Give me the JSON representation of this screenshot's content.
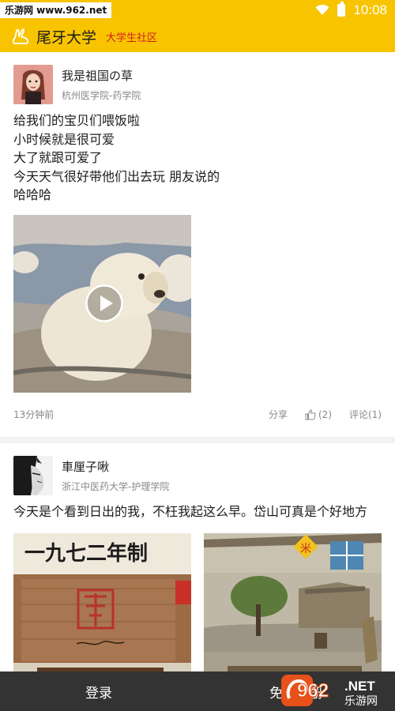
{
  "status_bar": {
    "watermark": "乐游网 www.962.net",
    "time": "10:08"
  },
  "app_bar": {
    "title": "尾牙大学",
    "subtitle": "大学生社区",
    "accent": "#f8c400"
  },
  "posts": [
    {
      "author": "我是祖国の草",
      "school": "杭州医学院-药学院",
      "lines": [
        "给我们的宝贝们喂饭啦",
        "小时候就是很可爱",
        "大了就跟可爱了",
        "今天天气很好带他们出去玩 朋友说的",
        "哈哈哈"
      ],
      "media": "video",
      "time": "13分钟前",
      "share_label": "分享",
      "likes": "(2)",
      "comments_label": "评论(1)"
    },
    {
      "author": "車厘子啾",
      "school": "浙江中医药大学-护理学院",
      "lines": [
        "今天是个看到日出的我，不枉我起这么早。岱山可真是个好地方"
      ],
      "media": "images",
      "images": [
        {
          "caption": "一九七二年制",
          "seal": "宣和"
        },
        {
          "sign": "米"
        }
      ]
    }
  ],
  "bottom_bar": {
    "login": "登录",
    "register": "免费注册",
    "brand_num": "962",
    "brand_dot_net": ".NET",
    "brand_cn": "乐游网"
  }
}
